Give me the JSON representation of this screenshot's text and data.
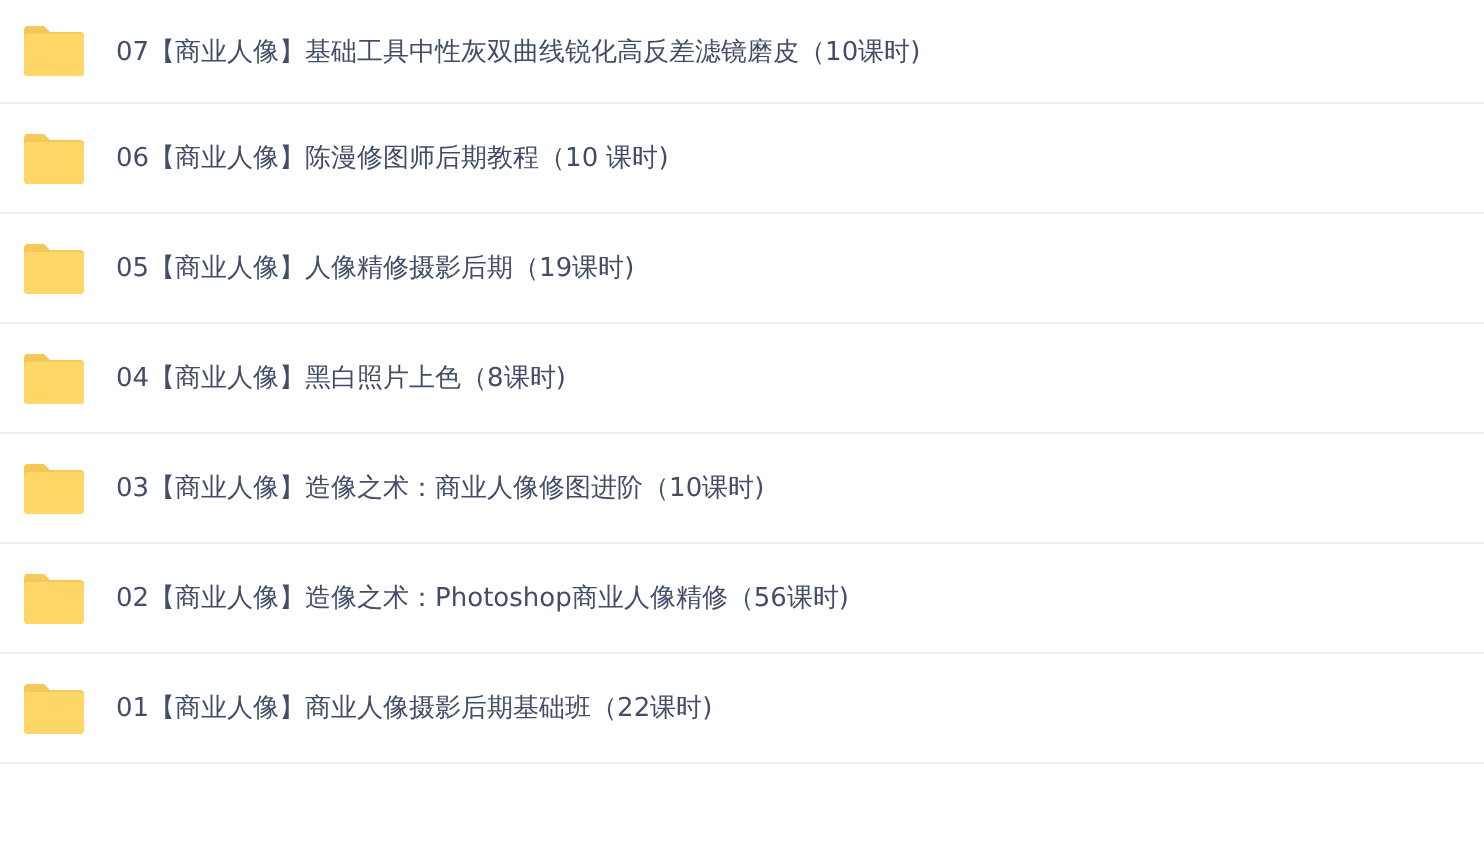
{
  "files": [
    {
      "name": "07【商业人像】基础工具中性灰双曲线锐化高反差滤镜磨皮（10课时)"
    },
    {
      "name": "06【商业人像】陈漫修图师后期教程（10 课时)"
    },
    {
      "name": "05【商业人像】人像精修摄影后期（19课时)"
    },
    {
      "name": "04【商业人像】黑白照片上色（8课时)"
    },
    {
      "name": "03【商业人像】造像之术：商业人像修图进阶（10课时)"
    },
    {
      "name": "02【商业人像】造像之术：Photoshop商业人像精修（56课时)"
    },
    {
      "name": "01【商业人像】商业人像摄影后期基础班（22课时)"
    }
  ]
}
